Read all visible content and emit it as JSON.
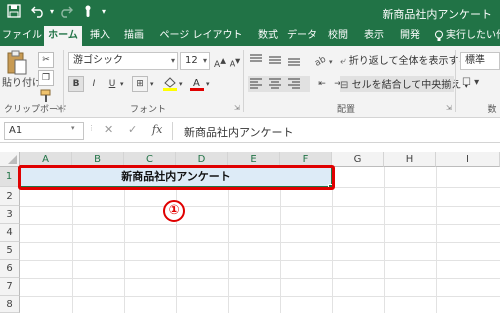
{
  "window": {
    "title": "新商品社内アンケート"
  },
  "quick_access": {
    "save_icon": "save-icon",
    "undo_icon": "undo-icon",
    "redo_icon": "redo-icon",
    "touch_icon": "touch-mode-icon"
  },
  "tabs": [
    {
      "label": "ファイル"
    },
    {
      "label": "ホーム"
    },
    {
      "label": "挿入"
    },
    {
      "label": "描画"
    },
    {
      "label": "ページ レイアウト"
    },
    {
      "label": "数式"
    },
    {
      "label": "データ"
    },
    {
      "label": "校閲"
    },
    {
      "label": "表示"
    },
    {
      "label": "開発"
    },
    {
      "label": "実行したい作"
    }
  ],
  "ribbon": {
    "clipboard": {
      "paste_label": "貼り付け",
      "group_label": "クリップボード"
    },
    "font": {
      "name": "游ゴシック",
      "size": "12",
      "group_label": "フォント",
      "bold": "B",
      "italic": "I",
      "underline": "U"
    },
    "alignment": {
      "wrap_label": "折り返して全体を表示する",
      "merge_label": "セルを結合して中央揃え",
      "group_label": "配置"
    },
    "number": {
      "format": "標準",
      "group_label": "数"
    }
  },
  "formula_bar": {
    "name_box": "A1",
    "fx": "fx",
    "content": "新商品社内アンケート",
    "cancel": "✕",
    "enter": "✓"
  },
  "grid": {
    "columns": [
      "A",
      "B",
      "C",
      "D",
      "E",
      "F",
      "G",
      "H",
      "I"
    ],
    "rows": [
      "1",
      "2",
      "3",
      "4",
      "5",
      "6",
      "7",
      "8"
    ],
    "merged_cell_text": "新商品社内アンケート"
  },
  "annotation": {
    "number": "①"
  },
  "colors": {
    "excel_green": "#217346",
    "highlight_red": "#e00000",
    "selected_fill": "#ddebf7"
  }
}
